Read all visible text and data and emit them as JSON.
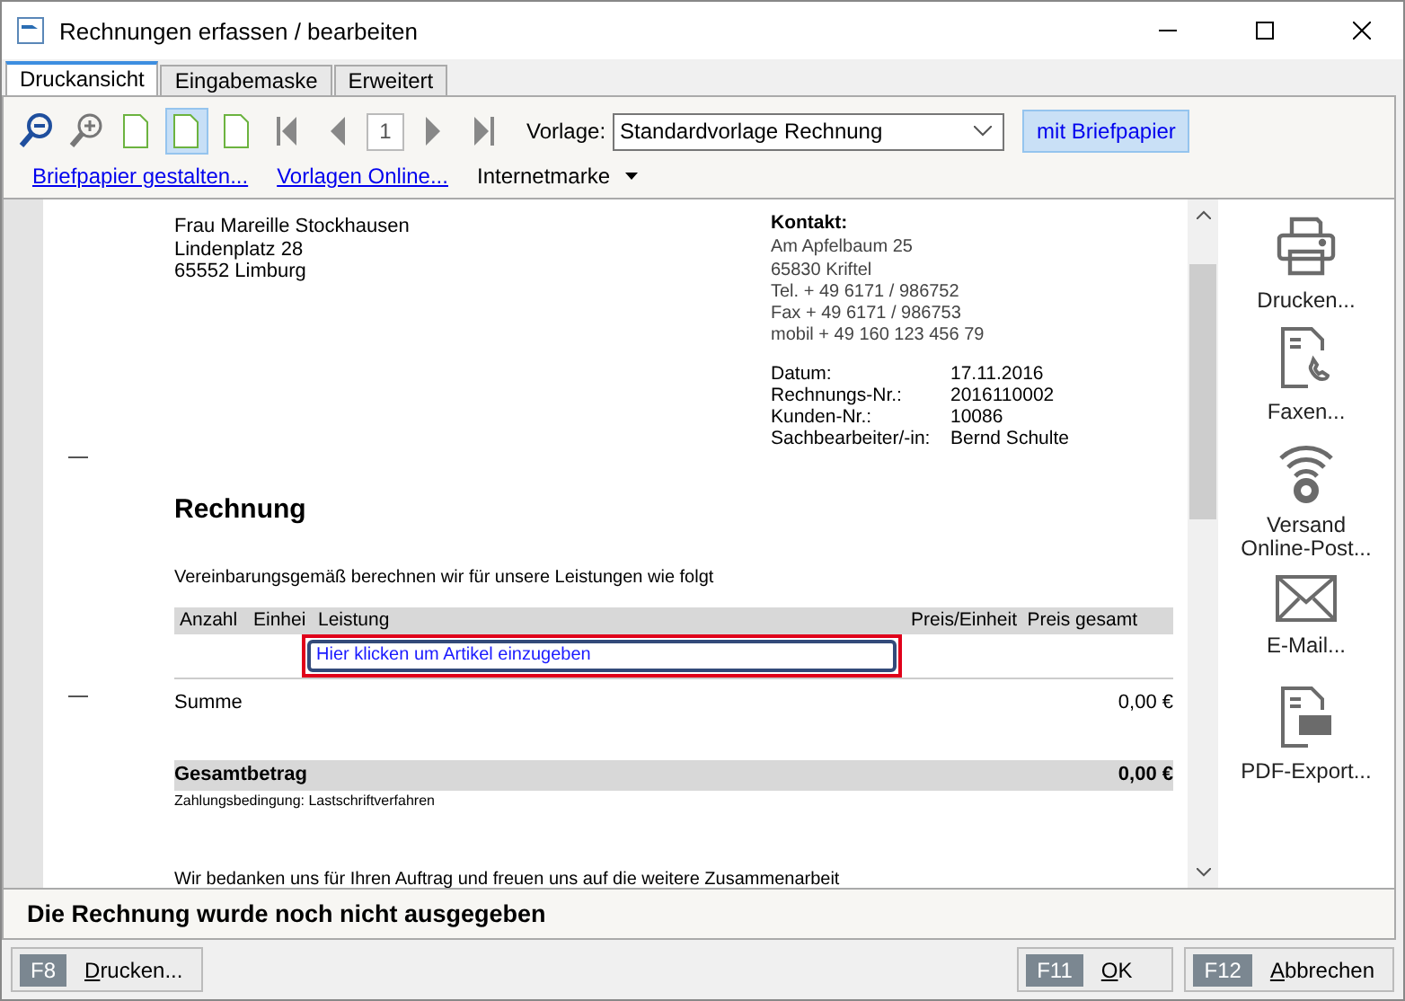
{
  "window": {
    "title": "Rechnungen erfassen / bearbeiten"
  },
  "tabs": [
    {
      "label": "Druckansicht",
      "selected": true
    },
    {
      "label": "Eingabemaske",
      "selected": false
    },
    {
      "label": "Erweitert",
      "selected": false
    }
  ],
  "toolbar": {
    "page_views": [
      {
        "selected": false
      },
      {
        "selected": true
      },
      {
        "selected": false
      }
    ],
    "page_number": "1",
    "template_label": "Vorlage:",
    "template_value": "Standardvorlage Rechnung",
    "letterhead_button": {
      "label": "mit Briefpapier",
      "selected": true
    }
  },
  "links": [
    {
      "label": "Briefpapier gestalten...",
      "kind": "link"
    },
    {
      "label": "Vorlagen Online...",
      "kind": "link"
    },
    {
      "label": "Internetmarke",
      "kind": "menu"
    }
  ],
  "document": {
    "recipient": [
      "Frau Mareille Stockhausen",
      "Lindenplatz 28",
      "65552 Limburg"
    ],
    "contact_heading": "Kontakt:",
    "contact_lines": [
      "Am Apfelbaum 25",
      "65830 Kriftel",
      "Tel. + 49 6171 / 986752",
      "Fax + 49 6171 / 986753",
      "mobil + 49 160 123 456 79"
    ],
    "meta": [
      {
        "label": "Datum:",
        "value": "17.11.2016"
      },
      {
        "label": "Rechnungs-Nr.:",
        "value": "2016110002"
      },
      {
        "label": "Kunden-Nr.:",
        "value": "10086"
      },
      {
        "label": "Sachbearbeiter/-in:",
        "value": "Bernd Schulte"
      }
    ],
    "title": "Rechnung",
    "intro": "Vereinbarungsgemäß berechnen wir für unsere Leistungen wie folgt",
    "columns": [
      "Anzahl",
      "Einhei",
      "Leistung",
      "Preis/Einheit",
      "Preis gesamt"
    ],
    "entry_placeholder": "Hier klicken um Artikel einzugeben",
    "sum": {
      "label": "Summe",
      "value": "0,00 €"
    },
    "total": {
      "label": "Gesamtbetrag",
      "value": "0,00 €"
    },
    "payment_terms": "Zahlungsbedingung: Lastschriftverfahren",
    "closing": "Wir bedanken uns für Ihren Auftrag und freuen uns auf die weitere Zusammenarbeit"
  },
  "actions": [
    {
      "label": "Drucken...",
      "kind": "print"
    },
    {
      "label": "Faxen...",
      "kind": "fax"
    },
    {
      "label": "Versand Online-Post...",
      "kind": "post"
    },
    {
      "label": "E-Mail...",
      "kind": "mail"
    },
    {
      "label": "PDF-Export...",
      "kind": "pdf"
    }
  ],
  "status_message": "Die Rechnung wurde noch nicht ausgegeben",
  "footer_buttons": [
    {
      "key": "F8",
      "label": "Drucken..."
    },
    {
      "key": "F11",
      "label": "OK"
    },
    {
      "key": "F12",
      "label": "Abbrechen"
    }
  ]
}
